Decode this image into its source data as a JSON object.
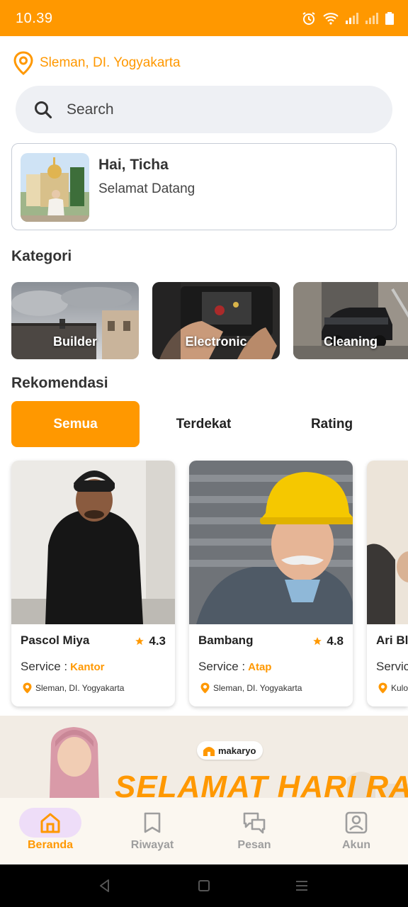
{
  "status_bar": {
    "time": "10.39",
    "icons": [
      "alarm-icon",
      "wifi-icon",
      "signal-icon",
      "signal-icon",
      "battery-icon"
    ]
  },
  "location": {
    "text": "Sleman, DI. Yogyakarta",
    "icon": "location-pin-icon"
  },
  "search": {
    "placeholder": "Search",
    "icon": "search-icon"
  },
  "greeting": {
    "title": "Hai, Ticha",
    "subtitle": "Selamat Datang"
  },
  "categories": {
    "title": "Kategori",
    "items": [
      {
        "label": "Builder"
      },
      {
        "label": "Electronic"
      },
      {
        "label": "Cleaning"
      }
    ]
  },
  "recommendations": {
    "title": "Rekomendasi",
    "tabs": [
      {
        "label": "Semua",
        "active": true
      },
      {
        "label": "Terdekat",
        "active": false
      },
      {
        "label": "Rating",
        "active": false
      }
    ],
    "workers": [
      {
        "name": "Pascol Miya",
        "rating": "4.3",
        "service_label": "Service :",
        "service": "Kantor",
        "location": "Sleman, DI. Yogyakarta"
      },
      {
        "name": "Bambang",
        "rating": "4.8",
        "service_label": "Service :",
        "service": "Atap",
        "location": "Sleman, DI. Yogyakarta"
      },
      {
        "name": "Ari Bl",
        "rating": "",
        "service_label": "Servic",
        "service": "",
        "location": "Kulo"
      }
    ]
  },
  "banner": {
    "brand": "makaryo",
    "headline": "SELAMAT HARI RAYA"
  },
  "bottom_nav": {
    "items": [
      {
        "label": "Beranda",
        "icon": "home-icon",
        "active": true
      },
      {
        "label": "Riwayat",
        "icon": "bookmark-icon",
        "active": false
      },
      {
        "label": "Pesan",
        "icon": "chat-icon",
        "active": false
      },
      {
        "label": "Akun",
        "icon": "account-icon",
        "active": false
      }
    ]
  },
  "colors": {
    "accent": "#FF9800",
    "nav_active_bg": "#EEDDF8",
    "search_bg": "#EEF0F4"
  }
}
